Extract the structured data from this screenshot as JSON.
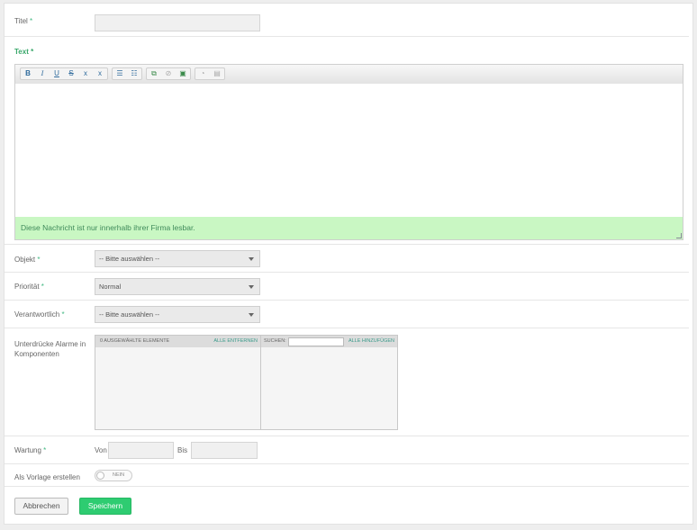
{
  "form": {
    "title_label": "Titel",
    "req_mark": " *",
    "title_value": "",
    "text_label": "Text",
    "editor": {
      "toolbar_buttons": [
        "bold-icon",
        "italic-icon",
        "underline-icon",
        "strikethrough-icon",
        "subscript-icon",
        "superscript-icon",
        "numbered-list-icon",
        "bulleted-list-icon",
        "insert-link-icon",
        "unlink-icon",
        "insert-image-icon",
        "paste-text-icon",
        "paste-word-icon"
      ],
      "toolbar_glyphs": [
        "B",
        "I",
        "U",
        "S",
        "x",
        "x",
        "☰",
        "☷",
        "⧉",
        "⊘",
        "▣",
        "◔",
        "▤"
      ],
      "notice": "Diese Nachricht ist nur innerhalb ihrer Firma lesbar."
    },
    "objekt_label": "Objekt",
    "objekt_value": "-- Bitte auswählen --",
    "prio_label": "Priorität",
    "prio_value": "Normal",
    "verantw_label": "Verantwortlich",
    "verantw_value": "-- Bitte auswählen --",
    "suppress_label_1": "Unterdrücke Alarme in",
    "suppress_label_2": "Komponenten",
    "multiselect": {
      "selected_count_label": "0 AUSGEWÄHLTE ELEMENTE",
      "remove_all": "ALLE ENTFERNEN",
      "search_label": "SUCHEN:",
      "search_value": "",
      "add_all": "ALLE HINZUFÜGEN"
    },
    "wartung_label": "Wartung",
    "wartung_req": " *",
    "von_label": "Von",
    "von_value": "",
    "bis_label": "Bis",
    "bis_value": "",
    "vorlage_label": "Als Vorlage erstellen",
    "vorlage_toggle": "NEIN",
    "cancel_button": "Abbrechen",
    "save_button": "Speichern"
  },
  "colors": {
    "accent": "#2ecc71",
    "notice_bg": "#c9f7c3",
    "required": "#42b883"
  }
}
